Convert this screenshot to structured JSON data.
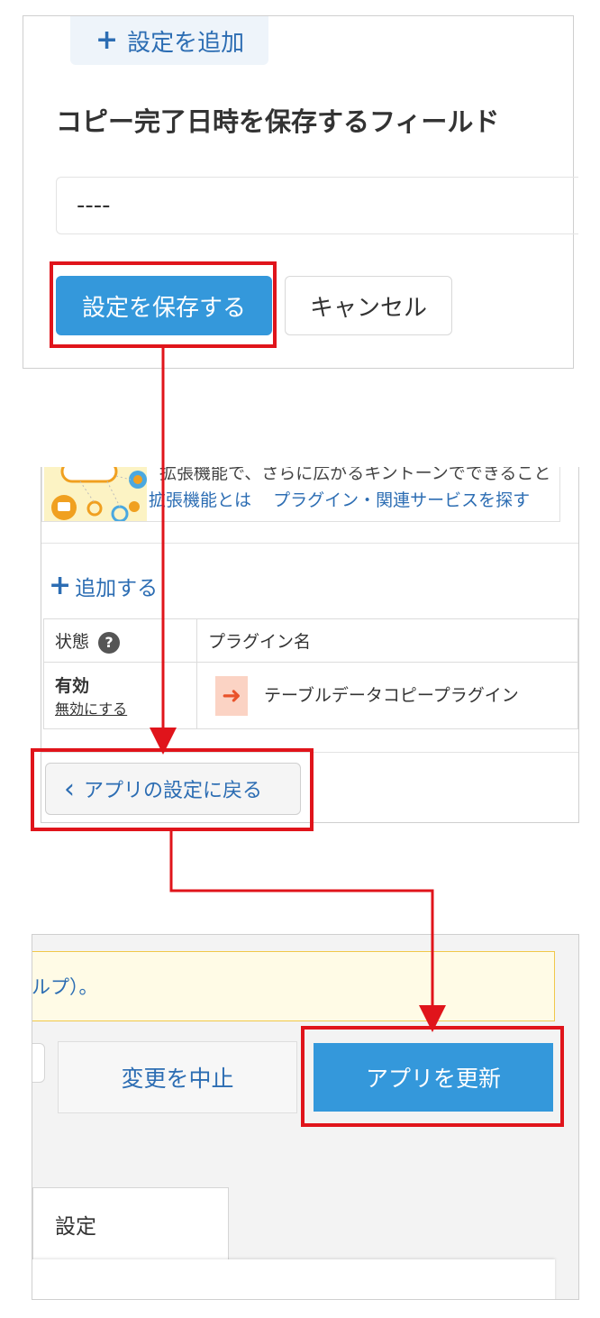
{
  "panel1": {
    "add_setting_label": "設定を追加",
    "field_title": "コピー完了日時を保存するフィールド",
    "field_value": "----",
    "save_label": "設定を保存する",
    "cancel_label": "キャンセル"
  },
  "panel2": {
    "promo_cut_text": "拡張機能で、さらに広がるキントーンでできること",
    "promo_link_1": "拡張機能とは",
    "promo_link_2": "プラグイン・関連サービスを探す",
    "add_label": "追加する",
    "col_status": "状態",
    "col_plugin": "プラグイン名",
    "status_value": "有効",
    "disable_label": "無効にする",
    "plugin_name": "テーブルデータコピープラグイン",
    "back_label": "アプリの設定に戻る"
  },
  "panel3": {
    "notice_text": "ルプ）。",
    "discard_label": "変更を中止",
    "update_label": "アプリを更新",
    "tab_label": "設定"
  },
  "colors": {
    "accent": "#3498db",
    "link": "#2c6db3",
    "highlight": "#e0141b"
  }
}
